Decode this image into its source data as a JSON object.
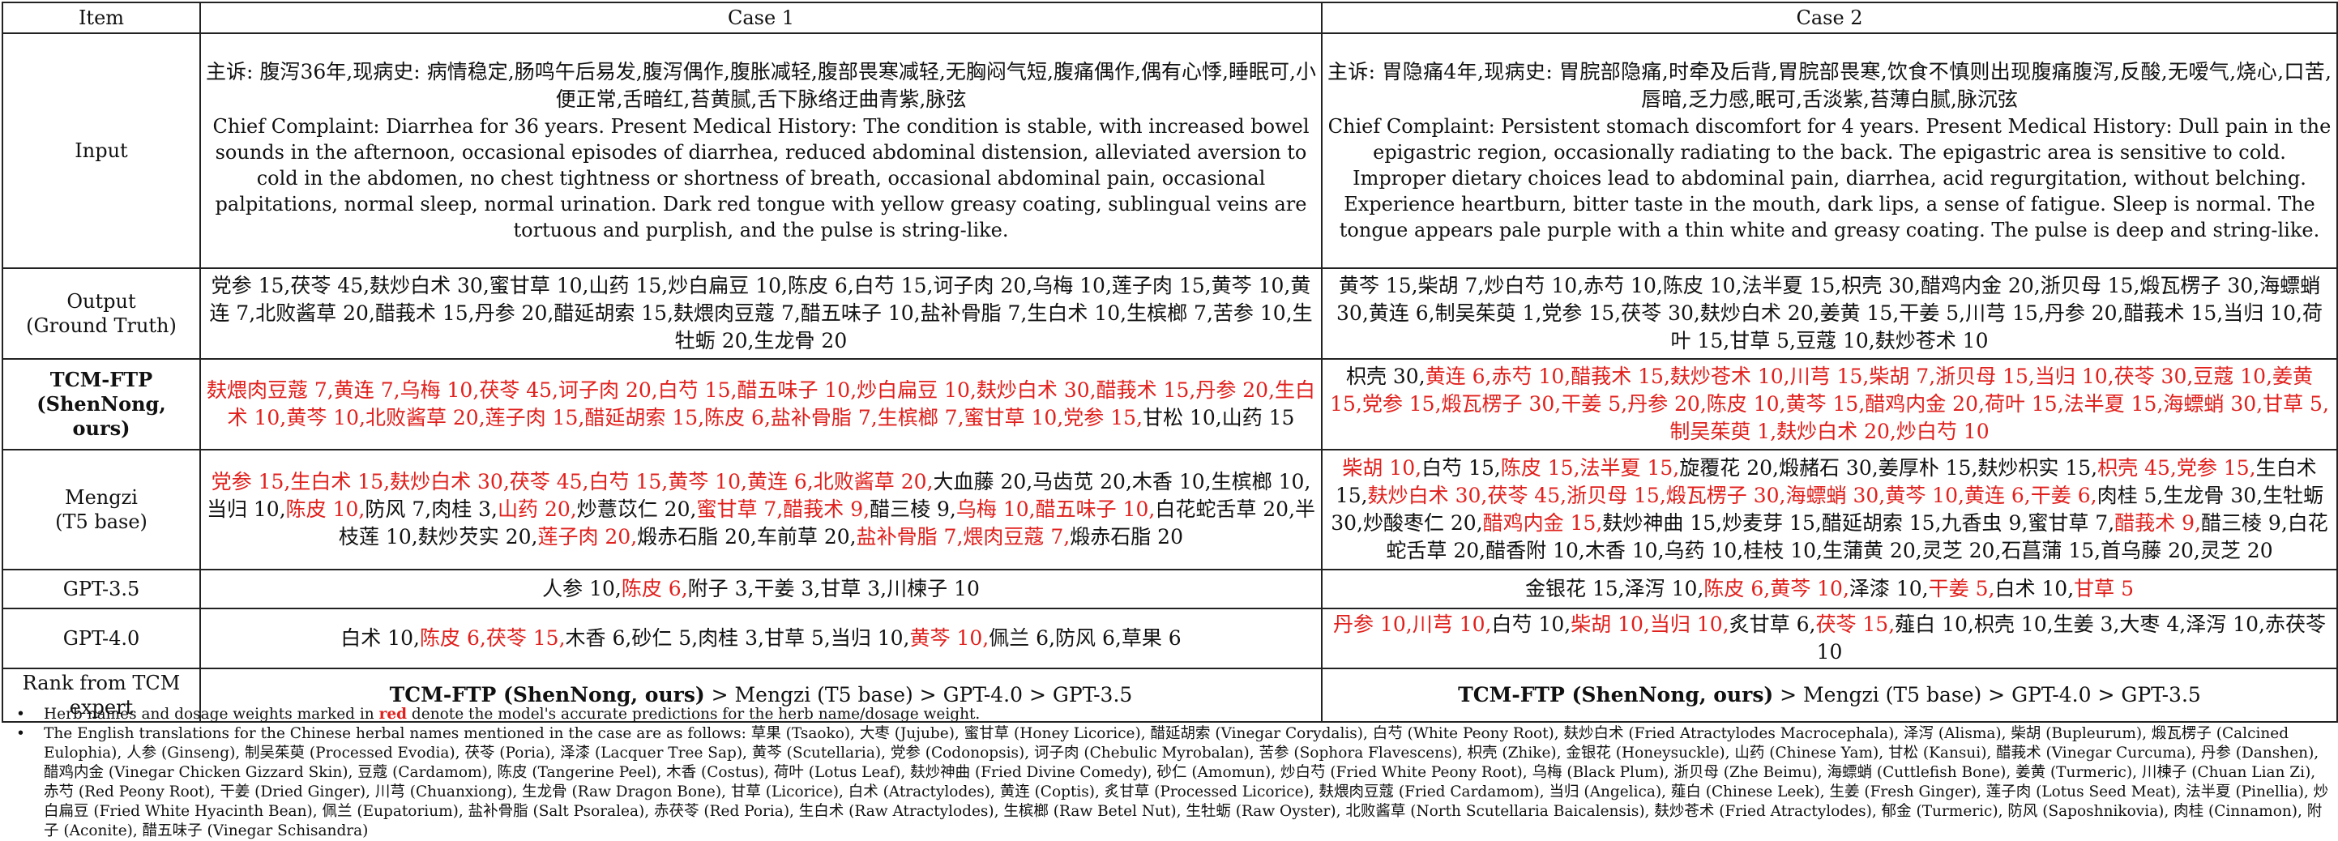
{
  "header": {
    "item": "Item",
    "case1": "Case 1",
    "case2": "Case 2"
  },
  "rows": {
    "input": {
      "label": "Input",
      "case1_zh": "主诉: 腹泻36年,现病史: 病情稳定,肠鸣午后易发,腹泻偶作,腹胀减轻,腹部畏寒减轻,无胸闷气短,腹痛偶作,偶有心悸,睡眠可,小便正常,舌暗红,苔黄腻,舌下脉络迂曲青紫,脉弦",
      "case1_en": "Chief Complaint: Diarrhea for 36 years. Present Medical History: The condition is stable, with increased bowel sounds in the afternoon, occasional episodes of diarrhea, reduced abdominal distension, alleviated aversion to cold in the abdomen, no chest tightness or shortness of breath, occasional abdominal pain, occasional palpitations, normal sleep, normal urination. Dark red tongue with yellow greasy coating, sublingual veins are tortuous and purplish, and the pulse is string-like.",
      "case2_zh": "主诉: 胃隐痛4年,现病史: 胃脘部隐痛,时牵及后背,胃脘部畏寒,饮食不慎则出现腹痛腹泻,反酸,无嗳气,烧心,口苦,唇暗,乏力感,眠可,舌淡紫,苔薄白腻,脉沉弦",
      "case2_en": "Chief Complaint: Persistent stomach discomfort for 4 years. Present Medical History: Dull pain in the epigastric region, occasionally radiating to the back. The epigastric area is sensitive to cold. Improper dietary choices lead to abdominal pain, diarrhea, acid regurgitation, without belching. Experience heartburn, bitter taste in the mouth, dark lips, a sense of fatigue. Sleep is normal. The tongue appears pale purple with a thin white and greasy coating. The pulse is deep and string-like."
    },
    "output": {
      "label": "Output",
      "label2": "(Ground Truth)",
      "case1": [
        {
          "t": "党参 15,",
          "ok": false
        },
        {
          "t": "茯苓 45,",
          "ok": false
        },
        {
          "t": "麸炒白术 30,",
          "ok": false
        },
        {
          "t": "蜜甘草 10,",
          "ok": false
        },
        {
          "t": "山药 15,",
          "ok": false
        },
        {
          "t": "炒白扁豆 10,",
          "ok": false
        },
        {
          "t": "陈皮 6,",
          "ok": false
        },
        {
          "t": "白芍 15,",
          "ok": false
        },
        {
          "t": "诃子肉 20,",
          "ok": false
        },
        {
          "t": "乌梅 10,",
          "ok": false
        },
        {
          "t": "莲子肉 15,",
          "ok": false
        },
        {
          "t": "黄芩 10,",
          "ok": false
        },
        {
          "t": "黄连 7,",
          "ok": false
        },
        {
          "t": "北败酱草 20,",
          "ok": false
        },
        {
          "t": "醋莪术 15,",
          "ok": false
        },
        {
          "t": "丹参 20,",
          "ok": false
        },
        {
          "t": "醋延胡索 15,",
          "ok": false
        },
        {
          "t": "麸煨肉豆蔻 7,",
          "ok": false
        },
        {
          "t": "醋五味子 10,",
          "ok": false
        },
        {
          "t": "盐补骨脂 7,",
          "ok": false
        },
        {
          "t": "生白术 10,",
          "ok": false
        },
        {
          "t": "生槟榔 7,",
          "ok": false
        },
        {
          "t": "苦参 10,",
          "ok": false
        },
        {
          "t": "生牡蛎 20,",
          "ok": false
        },
        {
          "t": "生龙骨 20",
          "ok": false
        }
      ],
      "case2": [
        {
          "t": "黄芩 15,",
          "ok": false
        },
        {
          "t": "柴胡 7,",
          "ok": false
        },
        {
          "t": "炒白芍 10,",
          "ok": false
        },
        {
          "t": "赤芍 10,",
          "ok": false
        },
        {
          "t": "陈皮 10,",
          "ok": false
        },
        {
          "t": "法半夏 15,",
          "ok": false
        },
        {
          "t": "枳壳 30,",
          "ok": false
        },
        {
          "t": "醋鸡内金 20,",
          "ok": false
        },
        {
          "t": "浙贝母 15,",
          "ok": false
        },
        {
          "t": "煅瓦楞子 30,",
          "ok": false
        },
        {
          "t": "海螵蛸 30,",
          "ok": false
        },
        {
          "t": "黄连 6,",
          "ok": false
        },
        {
          "t": "制吴茱萸 1,",
          "ok": false
        },
        {
          "t": "党参 15,",
          "ok": false
        },
        {
          "t": "茯苓 30,",
          "ok": false
        },
        {
          "t": "麸炒白术 20,",
          "ok": false
        },
        {
          "t": "姜黄 15,",
          "ok": false
        },
        {
          "t": "干姜 5,",
          "ok": false
        },
        {
          "t": "川芎 15,",
          "ok": false
        },
        {
          "t": "丹参 20,",
          "ok": false
        },
        {
          "t": "醋莪术 15,",
          "ok": false
        },
        {
          "t": "当归 10,",
          "ok": false
        },
        {
          "t": "荷叶 15,",
          "ok": false
        },
        {
          "t": "甘草 5,",
          "ok": false
        },
        {
          "t": "豆蔻 10,",
          "ok": false
        },
        {
          "t": "麸炒苍术 10",
          "ok": false
        }
      ]
    },
    "tcmftp": {
      "label": "TCM-FTP",
      "label2": "(ShenNong, ours)",
      "case1": [
        {
          "t": "麸煨肉豆蔻 7,",
          "ok": true
        },
        {
          "t": "黄连 7,",
          "ok": true
        },
        {
          "t": "乌梅 10,",
          "ok": true
        },
        {
          "t": "茯苓 45,",
          "ok": true
        },
        {
          "t": "诃子肉 20,",
          "ok": true
        },
        {
          "t": "白芍 15,",
          "ok": true
        },
        {
          "t": "醋五味子 10,",
          "ok": true
        },
        {
          "t": "炒白扁豆 10,",
          "ok": true
        },
        {
          "t": "麸炒白术 30,",
          "ok": true
        },
        {
          "t": "醋莪术 15,",
          "ok": true
        },
        {
          "t": "丹参 20,",
          "ok": true
        },
        {
          "t": "生白术 10,",
          "ok": true
        },
        {
          "t": "黄芩 10,",
          "ok": true
        },
        {
          "t": "北败酱草 20,",
          "ok": true
        },
        {
          "t": "莲子肉 15,",
          "ok": true
        },
        {
          "t": "醋延胡索 15,",
          "ok": true
        },
        {
          "t": "陈皮 6,",
          "ok": true
        },
        {
          "t": "盐补骨脂 7,",
          "ok": true
        },
        {
          "t": "生槟榔 7,",
          "ok": true
        },
        {
          "t": "蜜甘草 10,",
          "ok": true
        },
        {
          "t": "党参 15,",
          "ok": true
        },
        {
          "t": "甘松 10,",
          "ok": false
        },
        {
          "t": "山药 15",
          "ok": false
        }
      ],
      "case2": [
        {
          "t": "枳壳 30,",
          "ok": false
        },
        {
          "t": "黄连 6,",
          "ok": true
        },
        {
          "t": "赤芍 10,",
          "ok": true
        },
        {
          "t": "醋莪术 15,",
          "ok": true
        },
        {
          "t": "麸炒苍术 10,",
          "ok": true
        },
        {
          "t": "川芎 15,",
          "ok": true
        },
        {
          "t": "柴胡 7,",
          "ok": true
        },
        {
          "t": "浙贝母 15,",
          "ok": true
        },
        {
          "t": "当归 10,",
          "ok": true
        },
        {
          "t": "茯苓 30,",
          "ok": true
        },
        {
          "t": "豆蔻 10,",
          "ok": true
        },
        {
          "t": "姜黄 15,",
          "ok": true
        },
        {
          "t": "党参 15,",
          "ok": true
        },
        {
          "t": "煅瓦楞子 30,",
          "ok": true
        },
        {
          "t": "干姜 5,",
          "ok": true
        },
        {
          "t": "丹参 20,",
          "ok": true
        },
        {
          "t": "陈皮 10,",
          "ok": true
        },
        {
          "t": "黄芩 15,",
          "ok": true
        },
        {
          "t": "醋鸡内金 20,",
          "ok": true
        },
        {
          "t": "荷叶 15,",
          "ok": true
        },
        {
          "t": "法半夏 15,",
          "ok": true
        },
        {
          "t": "海螵蛸 30,",
          "ok": true
        },
        {
          "t": "甘草 5,",
          "ok": true
        },
        {
          "t": "制吴茱萸 1,",
          "ok": true
        },
        {
          "t": "麸炒白术 20,",
          "ok": true
        },
        {
          "t": "炒白芍 10",
          "ok": true
        }
      ]
    },
    "mengzi": {
      "label": "Mengzi",
      "label2": "(T5 base)",
      "case1": [
        {
          "t": "党参 15,",
          "ok": true
        },
        {
          "t": "生白术 15,",
          "ok": true
        },
        {
          "t": "麸炒白术 30,",
          "ok": true
        },
        {
          "t": "茯苓 45,",
          "ok": true
        },
        {
          "t": "白芍 15,",
          "ok": true
        },
        {
          "t": "黄芩 10,",
          "ok": true
        },
        {
          "t": "黄连 6,",
          "ok": true
        },
        {
          "t": "北败酱草 20,",
          "ok": true
        },
        {
          "t": "大血藤 20,",
          "ok": false
        },
        {
          "t": "马齿苋 20,",
          "ok": false
        },
        {
          "t": "木香 10,",
          "ok": false
        },
        {
          "t": "生槟榔 10,",
          "ok": false
        },
        {
          "t": "当归 10,",
          "ok": false
        },
        {
          "t": "陈皮 10,",
          "ok": true
        },
        {
          "t": "防风 7,",
          "ok": false
        },
        {
          "t": "肉桂 3,",
          "ok": false
        },
        {
          "t": "山药 20,",
          "ok": true
        },
        {
          "t": "炒薏苡仁 20,",
          "ok": false
        },
        {
          "t": "蜜甘草 7,",
          "ok": true
        },
        {
          "t": "醋莪术 9,",
          "ok": true
        },
        {
          "t": "醋三棱 9,",
          "ok": false
        },
        {
          "t": "乌梅 10,",
          "ok": true
        },
        {
          "t": "醋五味子 10,",
          "ok": true
        },
        {
          "t": "白花蛇舌草 20,",
          "ok": false
        },
        {
          "t": "半枝莲 10,",
          "ok": false
        },
        {
          "t": "麸炒芡实 20,",
          "ok": false
        },
        {
          "t": "莲子肉 20,",
          "ok": true
        },
        {
          "t": "煅赤石脂 20,",
          "ok": false
        },
        {
          "t": "车前草 20,",
          "ok": false
        },
        {
          "t": "盐补骨脂 7,",
          "ok": true
        },
        {
          "t": "煨肉豆蔻 7,",
          "ok": true
        },
        {
          "t": "煅赤石脂 20",
          "ok": false
        }
      ],
      "case2": [
        {
          "t": "柴胡 10,",
          "ok": true
        },
        {
          "t": "白芍 15,",
          "ok": false
        },
        {
          "t": "陈皮 15,",
          "ok": true
        },
        {
          "t": "法半夏 15,",
          "ok": true
        },
        {
          "t": "旋覆花 20,",
          "ok": false
        },
        {
          "t": "煅赭石 30,",
          "ok": false
        },
        {
          "t": "姜厚朴 15,",
          "ok": false
        },
        {
          "t": "麸炒枳实 15,",
          "ok": false
        },
        {
          "t": "枳壳 45,",
          "ok": true
        },
        {
          "t": "党参 15,",
          "ok": true
        },
        {
          "t": "生白术 15,",
          "ok": false
        },
        {
          "t": "麸炒白术 30,",
          "ok": true
        },
        {
          "t": "茯苓 45,",
          "ok": true
        },
        {
          "t": "浙贝母 15,",
          "ok": true
        },
        {
          "t": "煅瓦楞子 30,",
          "ok": true
        },
        {
          "t": "海螵蛸 30,",
          "ok": true
        },
        {
          "t": "黄芩 10,",
          "ok": true
        },
        {
          "t": "黄连 6,",
          "ok": true
        },
        {
          "t": "干姜 6,",
          "ok": true
        },
        {
          "t": "肉桂 5,",
          "ok": false
        },
        {
          "t": "生龙骨 30,",
          "ok": false
        },
        {
          "t": "生牡蛎 30,",
          "ok": false
        },
        {
          "t": "炒酸枣仁 20,",
          "ok": false
        },
        {
          "t": "醋鸡内金 15,",
          "ok": true
        },
        {
          "t": "麸炒神曲 15,",
          "ok": false
        },
        {
          "t": "炒麦芽 15,",
          "ok": false
        },
        {
          "t": "醋延胡索 15,",
          "ok": false
        },
        {
          "t": "九香虫 9,",
          "ok": false
        },
        {
          "t": "蜜甘草 7,",
          "ok": false
        },
        {
          "t": "醋莪术 9,",
          "ok": true
        },
        {
          "t": "醋三棱 9,",
          "ok": false
        },
        {
          "t": "白花蛇舌草 20,",
          "ok": false
        },
        {
          "t": "醋香附 10,",
          "ok": false
        },
        {
          "t": "木香 10,",
          "ok": false
        },
        {
          "t": "乌药 10,",
          "ok": false
        },
        {
          "t": "桂枝 10,",
          "ok": false
        },
        {
          "t": "生蒲黄 20,",
          "ok": false
        },
        {
          "t": "灵芝 20,",
          "ok": false
        },
        {
          "t": "石菖蒲 15,",
          "ok": false
        },
        {
          "t": "首乌藤 20,",
          "ok": false
        },
        {
          "t": "灵芝 20",
          "ok": false
        }
      ]
    },
    "gpt35": {
      "label": "GPT-3.5",
      "case1": [
        {
          "t": "人参 10,",
          "ok": false
        },
        {
          "t": "陈皮 6,",
          "ok": true
        },
        {
          "t": "附子 3,",
          "ok": false
        },
        {
          "t": "干姜 3,",
          "ok": false
        },
        {
          "t": "甘草 3,",
          "ok": false
        },
        {
          "t": "川楝子 10",
          "ok": false
        }
      ],
      "case2": [
        {
          "t": "金银花 15,",
          "ok": false
        },
        {
          "t": "泽泻 10,",
          "ok": false
        },
        {
          "t": "陈皮 6,",
          "ok": true
        },
        {
          "t": "黄芩 10,",
          "ok": true
        },
        {
          "t": "泽漆 10,",
          "ok": false
        },
        {
          "t": "干姜 5,",
          "ok": true
        },
        {
          "t": "白术 10,",
          "ok": false
        },
        {
          "t": "甘草 5",
          "ok": true
        }
      ]
    },
    "gpt40": {
      "label": "GPT-4.0",
      "case1": [
        {
          "t": "白术 10,",
          "ok": false
        },
        {
          "t": "陈皮 6,",
          "ok": true
        },
        {
          "t": "茯苓 15,",
          "ok": true
        },
        {
          "t": "木香 6,",
          "ok": false
        },
        {
          "t": "砂仁 5,",
          "ok": false
        },
        {
          "t": "肉桂 3,",
          "ok": false
        },
        {
          "t": "甘草 5,",
          "ok": false
        },
        {
          "t": "当归 10,",
          "ok": false
        },
        {
          "t": "黄芩 10,",
          "ok": true
        },
        {
          "t": "佩兰 6,",
          "ok": false
        },
        {
          "t": "防风 6,",
          "ok": false
        },
        {
          "t": "草果 6",
          "ok": false
        }
      ],
      "case2": [
        {
          "t": "丹参 10,",
          "ok": true
        },
        {
          "t": "川芎 10,",
          "ok": true
        },
        {
          "t": "白芍 10,",
          "ok": false
        },
        {
          "t": "柴胡 10,",
          "ok": true
        },
        {
          "t": "当归 10,",
          "ok": true
        },
        {
          "t": "炙甘草 6,",
          "ok": false
        },
        {
          "t": "茯苓 15,",
          "ok": true
        },
        {
          "t": "薤白 10,",
          "ok": false
        },
        {
          "t": "枳壳 10,",
          "ok": false
        },
        {
          "t": "生姜 3,",
          "ok": false
        },
        {
          "t": "大枣 4,",
          "ok": false
        },
        {
          "t": "泽泻 10,",
          "ok": false
        },
        {
          "t": "赤茯苓 10",
          "ok": false
        }
      ]
    },
    "rank": {
      "label": "Rank from TCM",
      "label2": "expert",
      "first": "TCM-FTP (ShenNong, ours)",
      "rest": " > Mengzi (T5 base) > GPT-4.0 > GPT-3.5"
    }
  },
  "notes": {
    "bullet": "•",
    "n1_a": "Herb names and dosage weights marked in ",
    "n1_red": "red",
    "n1_b": " denote the model's accurate predictions for the herb name/dosage weight.",
    "n2": "The English translations for the Chinese herbal names mentioned in the case are as follows: 草果 (Tsaoko), 大枣 (Jujube), 蜜甘草 (Honey Licorice), 醋延胡索 (Vinegar Corydalis), 白芍 (White Peony Root), 麸炒白术 (Fried Atractylodes Macrocephala), 泽泻 (Alisma), 柴胡 (Bupleurum), 煅瓦楞子 (Calcined Eulophia), 人参 (Ginseng), 制吴茱萸 (Processed Evodia), 茯苓 (Poria), 泽漆 (Lacquer Tree Sap), 黄芩 (Scutellaria), 党参 (Codonopsis), 诃子肉 (Chebulic Myrobalan), 苦参 (Sophora Flavescens), 枳壳 (Zhike), 金银花 (Honeysuckle), 山药 (Chinese Yam), 甘松 (Kansui), 醋莪术 (Vinegar Curcuma), 丹参 (Danshen), 醋鸡内金 (Vinegar Chicken Gizzard Skin), 豆蔻 (Cardamom), 陈皮 (Tangerine Peel), 木香 (Costus), 荷叶 (Lotus Leaf), 麸炒神曲 (Fried Divine Comedy), 砂仁 (Amomun), 炒白芍 (Fried White Peony Root), 乌梅 (Black Plum), 浙贝母 (Zhe Beimu), 海螵蛸 (Cuttlefish Bone), 姜黄 (Turmeric), 川楝子 (Chuan Lian Zi), 赤芍 (Red Peony Root), 干姜 (Dried Ginger), 川芎 (Chuanxiong), 生龙骨 (Raw Dragon Bone), 甘草 (Licorice), 白术 (Atractylodes), 黄连 (Coptis), 炙甘草 (Processed Licorice), 麸煨肉豆蔻 (Fried Cardamom), 当归 (Angelica), 薤白 (Chinese Leek), 生姜 (Fresh Ginger), 莲子肉 (Lotus Seed Meat), 法半夏 (Pinellia), 炒白扁豆 (Fried White Hyacinth Bean), 佩兰 (Eupatorium), 盐补骨脂 (Salt Psoralea), 赤茯苓 (Red Poria), 生白术 (Raw Atractylodes), 生槟榔 (Raw Betel Nut), 生牡蛎 (Raw Oyster), 北败酱草 (North Scutellaria Baicalensis), 麸炒苍术 (Fried Atractylodes), 郁金 (Turmeric), 防风 (Saposhnikovia), 肉桂 (Cinnamon), 附子 (Aconite), 醋五味子 (Vinegar Schisandra)"
  }
}
